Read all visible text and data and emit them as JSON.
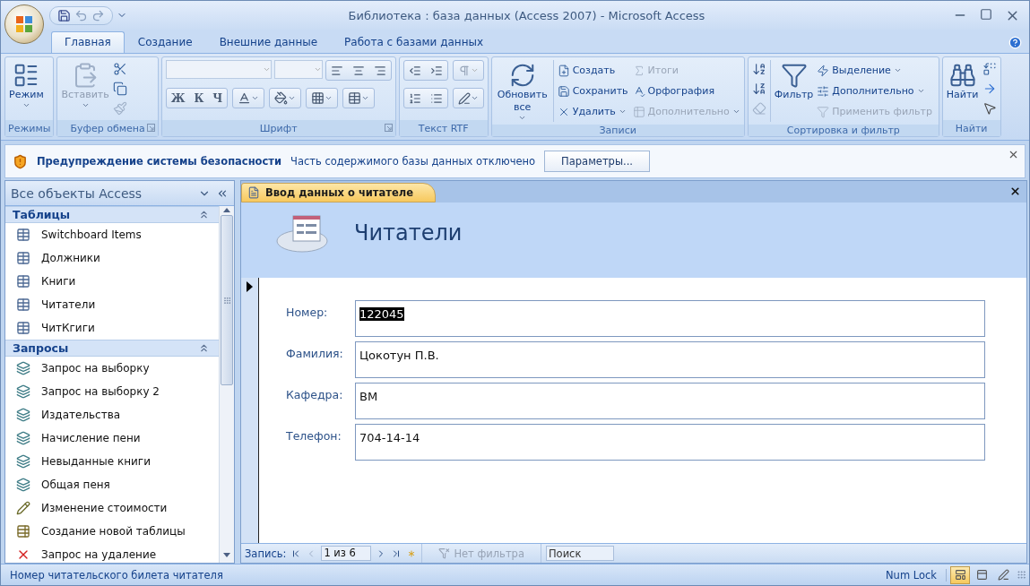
{
  "window": {
    "title": "Библиотека : база данных (Access 2007) - Microsoft Access"
  },
  "ribbon": {
    "tabs": [
      {
        "label": "Главная",
        "selected": true
      },
      {
        "label": "Создание",
        "selected": false
      },
      {
        "label": "Внешние данные",
        "selected": false
      },
      {
        "label": "Работа с базами данных",
        "selected": false
      }
    ],
    "groups": [
      {
        "kind": "views",
        "label": "Режимы",
        "items": [
          {
            "label": "Режим",
            "kind": "large",
            "disabled": false,
            "dropdown": true
          }
        ]
      },
      {
        "kind": "clipboard",
        "label": "Буфер обмена",
        "launcher": true,
        "items": [
          {
            "label": "Вставить",
            "kind": "large",
            "disabled": true,
            "dropdown": true
          }
        ]
      },
      {
        "kind": "font",
        "label": "Шрифт",
        "launcher": true,
        "items": [
          {
            "label": "Ж",
            "kind": "style",
            "disabled": false
          },
          {
            "label": "К",
            "kind": "style",
            "disabled": false
          },
          {
            "label": "Ч",
            "kind": "style",
            "disabled": false
          }
        ]
      },
      {
        "kind": "rtf",
        "label": "Текст RTF"
      },
      {
        "kind": "records",
        "label": "Записи",
        "items": [
          {
            "label": "Обновить все",
            "kind": "large",
            "disabled": false,
            "dropdown": true
          },
          {
            "label": "Создать",
            "kind": "small",
            "disabled": false,
            "dropdown": false
          },
          {
            "label": "Сохранить",
            "kind": "small",
            "disabled": false,
            "dropdown": false
          },
          {
            "label": "Удалить",
            "kind": "small",
            "disabled": false,
            "dropdown": true
          },
          {
            "label": "Итоги",
            "kind": "small",
            "disabled": true,
            "dropdown": false
          },
          {
            "label": "Орфография",
            "kind": "small",
            "disabled": false,
            "dropdown": false
          },
          {
            "label": "Дополнительно",
            "kind": "small",
            "disabled": true,
            "dropdown": true
          }
        ]
      },
      {
        "kind": "sort",
        "label": "Сортировка и фильтр",
        "items": [
          {
            "label": "Фильтр",
            "kind": "large",
            "disabled": false,
            "dropdown": false
          },
          {
            "label": "Выделение",
            "kind": "small",
            "disabled": false,
            "dropdown": true
          },
          {
            "label": "Дополнительно",
            "kind": "small",
            "disabled": false,
            "dropdown": true
          },
          {
            "label": "Применить фильтр",
            "kind": "small",
            "disabled": true,
            "dropdown": false
          }
        ]
      },
      {
        "kind": "find",
        "label": "Найти",
        "items": [
          {
            "label": "Найти",
            "kind": "large",
            "disabled": false,
            "dropdown": false
          }
        ]
      }
    ]
  },
  "security_bar": {
    "title": "Предупреждение системы безопасности",
    "message": "Часть содержимого базы данных отключено",
    "button": "Параметры..."
  },
  "navigation": {
    "title": "Все объекты Access",
    "groups": [
      {
        "label": "Таблицы",
        "expanded": true,
        "items": [
          {
            "label": "Switchboard Items",
            "kind": "table"
          },
          {
            "label": "Должники",
            "kind": "table"
          },
          {
            "label": "Книги",
            "kind": "table"
          },
          {
            "label": "Читатели",
            "kind": "table"
          },
          {
            "label": "ЧитКгиги",
            "kind": "table"
          }
        ]
      },
      {
        "label": "Запросы",
        "expanded": true,
        "items": [
          {
            "label": "Запрос на выборку",
            "kind": "select"
          },
          {
            "label": "Запрос на выборку 2",
            "kind": "select"
          },
          {
            "label": "Издательства",
            "kind": "select"
          },
          {
            "label": "Начисление пени",
            "kind": "select"
          },
          {
            "label": "Невыданные книги",
            "kind": "select"
          },
          {
            "label": "Общая пеня",
            "kind": "select"
          },
          {
            "label": "Изменение стоимости",
            "kind": "update"
          },
          {
            "label": "Создание новой таблицы",
            "kind": "maketable"
          },
          {
            "label": "Запрос на удаление",
            "kind": "delete"
          }
        ]
      }
    ]
  },
  "document": {
    "tab": {
      "label": "Ввод данных о читателе",
      "selected": true
    },
    "form_title": "Читатели",
    "fields": [
      {
        "label": "Номер:",
        "value": "122045",
        "highlighted": true
      },
      {
        "label": "Фамилия:",
        "value": "Цокотун П.В.",
        "highlighted": false
      },
      {
        "label": "Кафедра:",
        "value": "ВМ",
        "highlighted": false
      },
      {
        "label": "Телефон:",
        "value": "704-14-14",
        "highlighted": false
      }
    ],
    "record_nav": {
      "label": "Запись:",
      "position": "1 из 6",
      "filter": "Нет фильтра",
      "search_placeholder": "Поиск"
    }
  },
  "status_bar": {
    "text": "Номер читательского билета читателя",
    "num_lock": "Num Lock",
    "views": [
      {
        "selected": true
      },
      {
        "selected": false
      },
      {
        "selected": false
      }
    ]
  }
}
